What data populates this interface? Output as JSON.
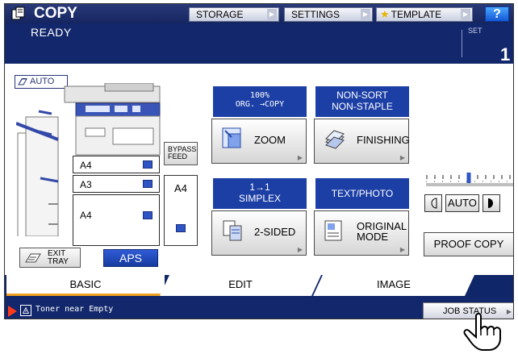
{
  "header": {
    "title": "COPY",
    "storage_label": "STORAGE",
    "settings_label": "SETTINGS",
    "template_label": "TEMPLATE",
    "help_label": "?"
  },
  "status": {
    "message": "READY",
    "set_label": "SET",
    "set_value": "1"
  },
  "paper": {
    "auto_label": "AUTO",
    "trays": [
      "A4",
      "A3",
      "A4"
    ],
    "bypass_label_1": "BYPASS",
    "bypass_label_2": "FEED",
    "bypass_size": "A4",
    "exit_label_1": "EXIT",
    "exit_label_2": "TRAY",
    "aps_label": "APS"
  },
  "functions": {
    "zoom_status_1": "100%",
    "zoom_status_2": "ORG. →COPY",
    "zoom_label": "ZOOM",
    "finishing_status_1": "NON-SORT",
    "finishing_status_2": "NON-STAPLE",
    "finishing_label": "FINISHING",
    "duplex_status_1": "1→1",
    "duplex_status_2": "SIMPLEX",
    "duplex_label": "2-SIDED",
    "mode_status": "TEXT/PHOTO",
    "mode_label_1": "ORIGINAL",
    "mode_label_2": "MODE"
  },
  "density": {
    "auto_label": "AUTO",
    "level": 0.5
  },
  "proof_label": "PROOF COPY",
  "tabs": {
    "basic": "BASIC",
    "edit": "EDIT",
    "image": "IMAGE"
  },
  "message_bar": {
    "text": "Toner near Empty",
    "job_status_label": "JOB STATUS"
  }
}
